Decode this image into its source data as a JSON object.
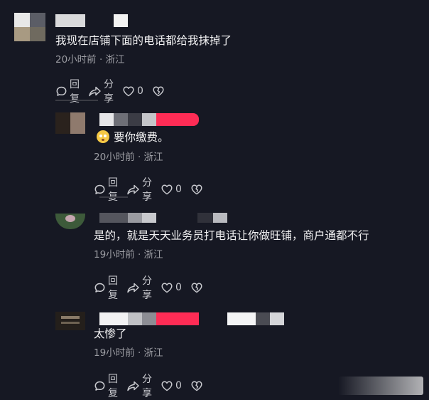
{
  "comments": [
    {
      "text": "我现在店铺下面的电话都给我抹掉了",
      "meta": "20小时前 · 浙江",
      "reply_label": "回复",
      "share_label": "分享",
      "like_count": "0"
    },
    {
      "text": "要你缴费。",
      "meta": "20小时前 · 浙江",
      "reply_label": "回复",
      "share_label": "分享",
      "like_count": "0"
    },
    {
      "text": "是的，就是天天业务员打电话让你做旺铺，商户通都不行",
      "meta": "19小时前 · 浙江",
      "reply_label": "回复",
      "share_label": "分享",
      "like_count": "0"
    },
    {
      "text": "太惨了",
      "meta": "19小时前 · 浙江",
      "reply_label": "回复",
      "share_label": "分享",
      "like_count": "0"
    }
  ],
  "icons": {
    "reply": "reply-icon",
    "share": "share-icon",
    "like": "heart-icon",
    "dislike": "broken-heart-icon"
  },
  "colors": {
    "background": "#161823",
    "meta": "#9c9da3",
    "accent": "#fe2c55"
  }
}
